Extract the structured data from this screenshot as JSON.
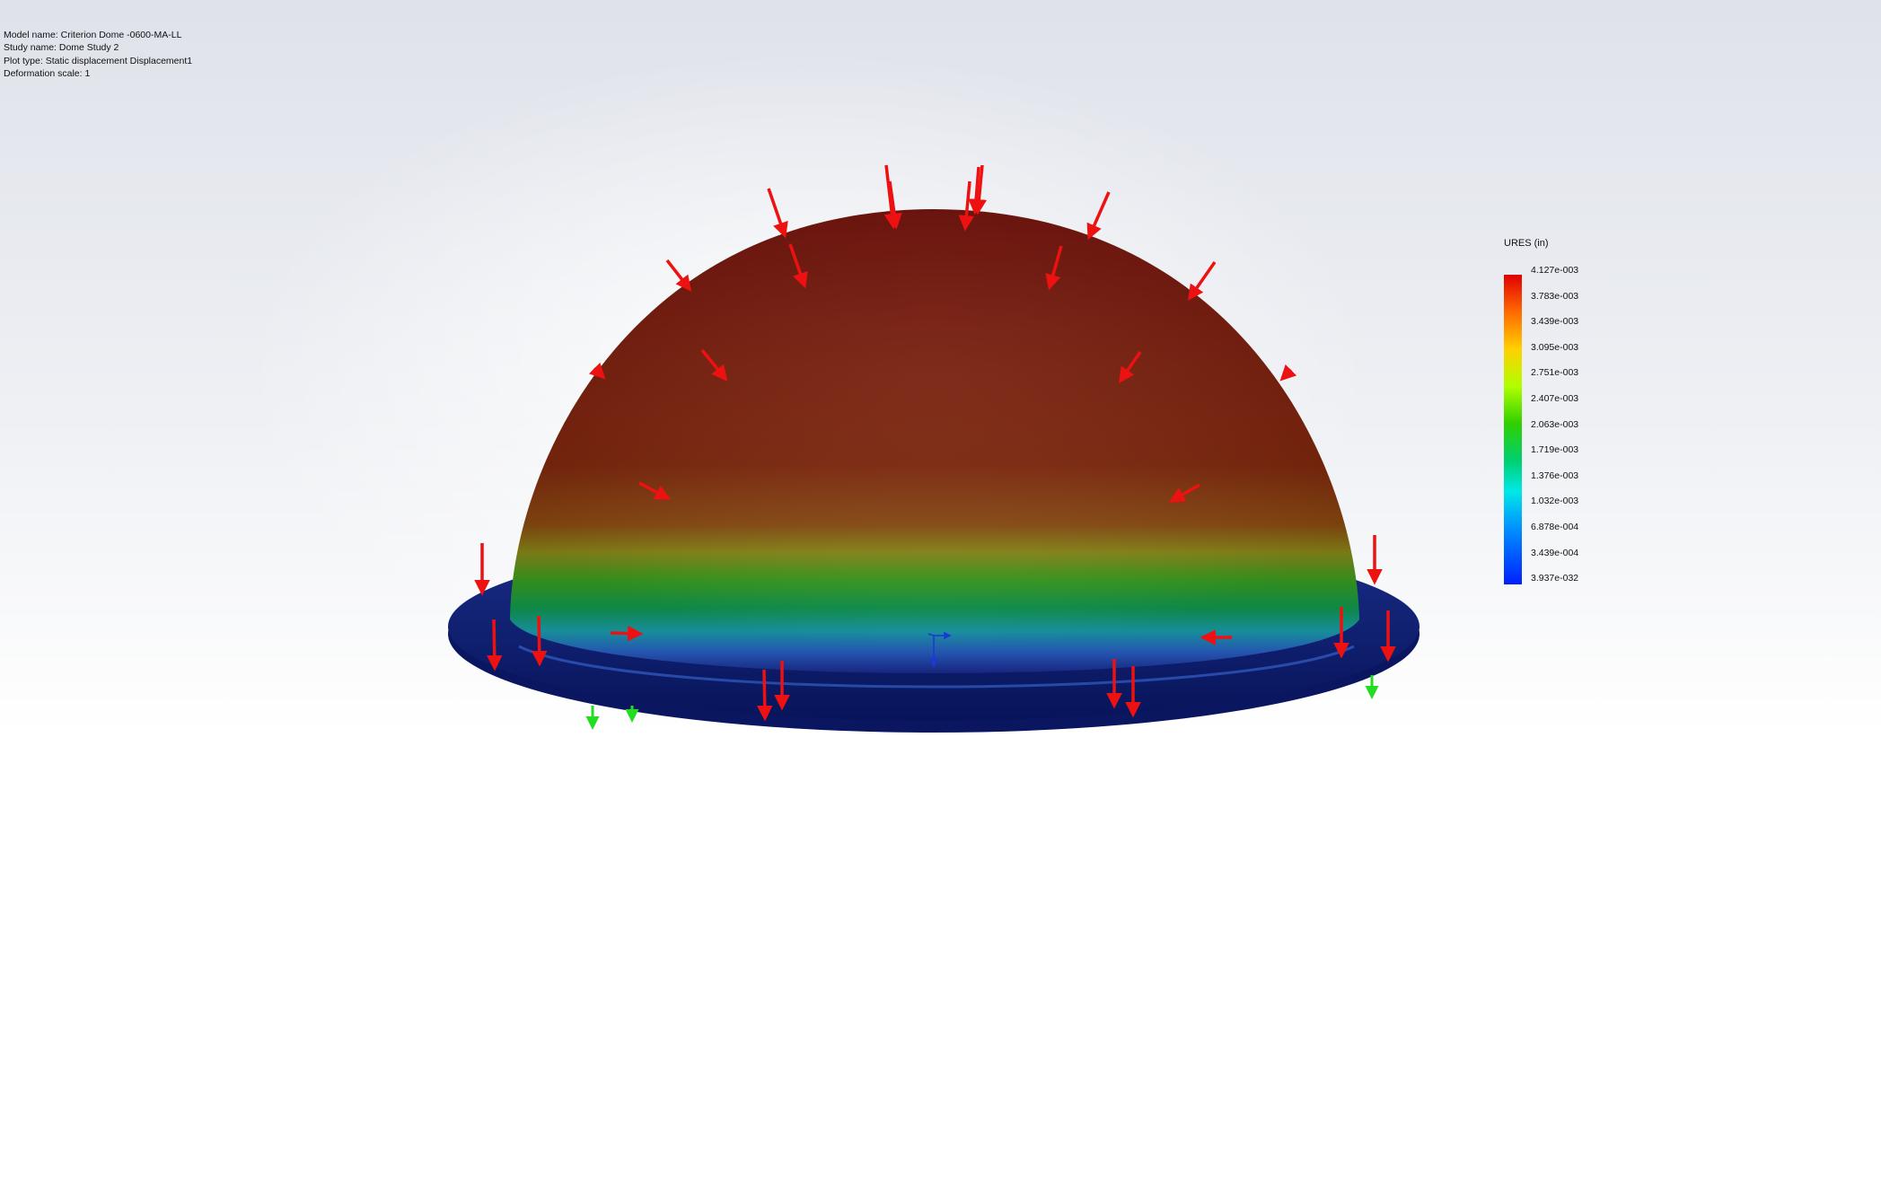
{
  "info": {
    "model_name": "Model name: Criterion Dome -0600-MA-LL",
    "study_name": "Study name: Dome Study 2",
    "plot_type": "Plot type: Static displacement Displacement1",
    "deformation_scale": "Deformation scale: 1"
  },
  "legend": {
    "title": "URES (in)",
    "labels": [
      "4.127e-003",
      "3.783e-003",
      "3.439e-003",
      "3.095e-003",
      "2.751e-003",
      "2.407e-003",
      "2.063e-003",
      "1.719e-003",
      "1.376e-003",
      "1.032e-003",
      "6.878e-004",
      "3.439e-004",
      "3.937e-032"
    ]
  },
  "colors": {
    "load_arrow": "#ee1111",
    "fixture_arrow": "#22dd22",
    "dome_top": "#6a0e04",
    "flange": "#0a1a66"
  },
  "icons": [
    "load-arrow-icon",
    "fixture-arrow-icon",
    "coordinate-triad-icon"
  ]
}
